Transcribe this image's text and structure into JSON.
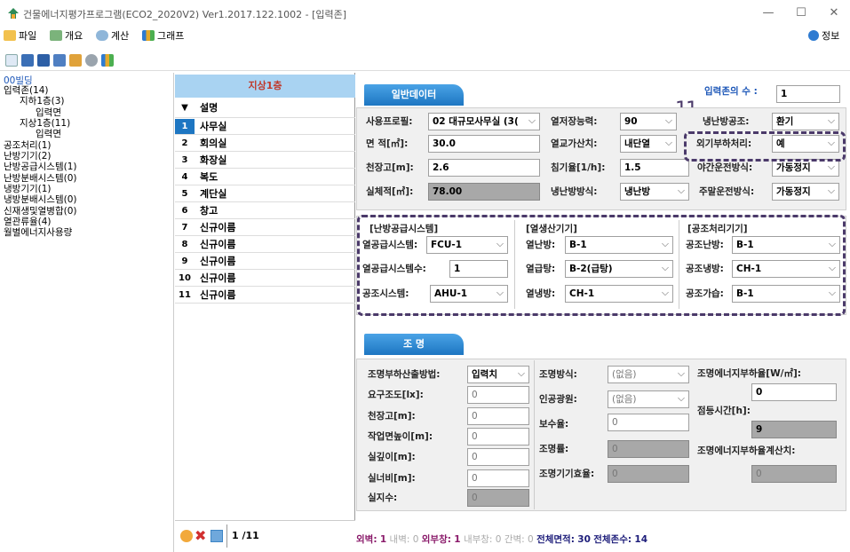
{
  "window": {
    "title": "건물에너지평가프로그램(ECO2_2020V2) Ver1.2017.122.1002 - [입력존]",
    "minimize": "—",
    "maximize": "☐",
    "close": "✕"
  },
  "menu": {
    "file": "파일",
    "overview": "개요",
    "calc": "계산",
    "graph": "그래프",
    "info": "정보"
  },
  "tree": [
    {
      "label": "00빌딩",
      "depth": 0
    },
    {
      "label": "입력존(14)",
      "depth": 0
    },
    {
      "label": "지하1층(3)",
      "depth": 1
    },
    {
      "label": "입력면",
      "depth": 2
    },
    {
      "label": "지상1층(11)",
      "depth": 1
    },
    {
      "label": "입력면",
      "depth": 2
    },
    {
      "label": "공조처리(1)",
      "depth": 0
    },
    {
      "label": "난방기기(2)",
      "depth": 0
    },
    {
      "label": "난방공급시스템(1)",
      "depth": 0
    },
    {
      "label": "난방분배시스템(0)",
      "depth": 0
    },
    {
      "label": "냉방기기(1)",
      "depth": 0
    },
    {
      "label": "냉방분배시스템(0)",
      "depth": 0
    },
    {
      "label": "신재생및열병합(0)",
      "depth": 0
    },
    {
      "label": "열관류율(4)",
      "depth": 0
    },
    {
      "label": "월별에너지사용량",
      "depth": 0
    }
  ],
  "zones": {
    "header": "지상1층",
    "col_marker": "▼",
    "col_desc": "설명",
    "rows": [
      {
        "n": "1",
        "name": "사무실"
      },
      {
        "n": "2",
        "name": "회의실"
      },
      {
        "n": "3",
        "name": "화장실"
      },
      {
        "n": "4",
        "name": "복도"
      },
      {
        "n": "5",
        "name": "계단실"
      },
      {
        "n": "6",
        "name": "창고"
      },
      {
        "n": "7",
        "name": "신규이름"
      },
      {
        "n": "8",
        "name": "신규이름"
      },
      {
        "n": "9",
        "name": "신규이름"
      },
      {
        "n": "10",
        "name": "신규이름"
      },
      {
        "n": "11",
        "name": "신규이름"
      }
    ],
    "pager": "1 /11"
  },
  "general": {
    "tab": "일반데이터",
    "zone_count_label": "입력존의 수 :",
    "zone_count": "1",
    "annotation": "11",
    "use_profile_label": "사용프로필:",
    "use_profile": "02 대규모사무실 (3(",
    "heat_storage_label": "열저장능력:",
    "heat_storage": "90",
    "hvac_label": "냉난방공조:",
    "hvac": "환기",
    "area_label": "면 적[㎡]:",
    "area": "30.0",
    "heat_exchange_label": "열교가산치:",
    "heat_exchange": "내단열",
    "external_load_label": "외기부하처리:",
    "external_load": "예",
    "ceiling_label": "천장고[m]:",
    "ceiling": "2.6",
    "infiltration_label": "침기율[1/h]:",
    "infiltration": "1.5",
    "night_op_label": "야간운전방식:",
    "night_op": "가동정지",
    "volume_label": "실체적[㎥]:",
    "volume": "78.00",
    "hc_mode_label": "냉난방방식:",
    "hc_mode": "냉난방",
    "weekend_label": "주말운전방식:",
    "weekend": "가동정지"
  },
  "systems": {
    "heating_supply_header": "[난방공급시스템]",
    "heat_supply_label": "열공급시스템:",
    "heat_supply": "FCU-1",
    "heat_supply_count_label": "열공급시스템수:",
    "heat_supply_count": "1",
    "ahu_label": "공조시스템:",
    "ahu": "AHU-1",
    "heat_gen_header": "[열생산기기]",
    "heating_label": "열난방:",
    "heating": "B-1",
    "hot_water_label": "열급탕:",
    "hot_water": "B-2(급탕)",
    "cooling_label": "열냉방:",
    "cooling": "CH-1",
    "ac_header": "[공조처리기기]",
    "ac_heating_label": "공조난방:",
    "ac_heating": "B-1",
    "ac_cooling_label": "공조냉방:",
    "ac_cooling": "CH-1",
    "ac_humid_label": "공조가습:",
    "ac_humid": "B-1"
  },
  "lighting": {
    "tab": "조 명",
    "calc_method_label": "조명부하산출방법:",
    "calc_method": "입력치",
    "req_lux_label": "요구조도[lx]:",
    "req_lux": "0",
    "ceiling_label": "천장고[m]:",
    "ceiling": "0",
    "work_height_label": "작업면높이[m]:",
    "work_height": "0",
    "room_depth_label": "실깊이[m]:",
    "room_depth": "0",
    "room_width_label": "실너비[m]:",
    "room_width": "0",
    "room_index_label": "실지수:",
    "room_index": "0",
    "method_label": "조명방식:",
    "method": "(없음)",
    "source_label": "인공광원:",
    "source": "(없음)",
    "maint_label": "보수율:",
    "maint": "0",
    "lighting_rate_label": "조명률:",
    "lighting_rate": "0",
    "fixture_eff_label": "조명기기효율:",
    "fixture_eff": "0",
    "energy_load_label": "조명에너지부하율[W/㎡]:",
    "energy_load": "0",
    "on_time_label": "점등시간[h]:",
    "on_time": "9",
    "energy_calc_label": "조명에너지부하율계산치:",
    "energy_calc": "0"
  },
  "status": {
    "wall_label": "외벽:",
    "wall": "1",
    "inner_wall": "내벽: 0",
    "window_label": "외부창:",
    "window": "1",
    "inner_window": "내부창: 0",
    "partition": "간벽: 0",
    "total_area_label": "전체면적:",
    "total_area": "30",
    "total_zones_label": "전체존수:",
    "total_zones": "14"
  },
  "colors": {
    "accent": "#1d76c2",
    "zone_header_bg": "#a9d3f2",
    "zone_header_text": "#c0392b",
    "annotation": "#4b3a6a"
  }
}
